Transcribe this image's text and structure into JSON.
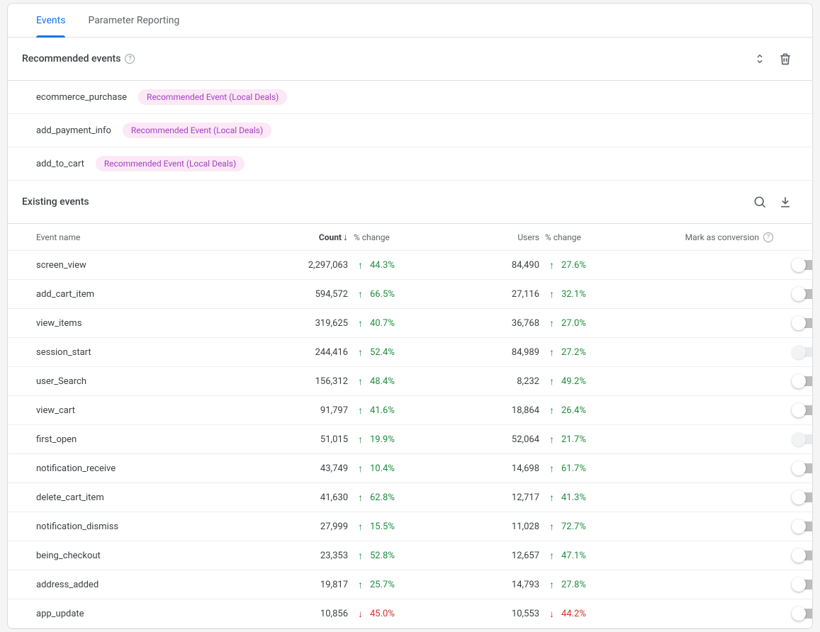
{
  "tabs": {
    "events": "Events",
    "parameter_reporting": "Parameter Reporting"
  },
  "recommended": {
    "header": "Recommended events",
    "items": [
      {
        "name": "ecommerce_purchase",
        "badge": "Recommended Event (Local Deals)"
      },
      {
        "name": "add_payment_info",
        "badge": "Recommended Event (Local Deals)"
      },
      {
        "name": "add_to_cart",
        "badge": "Recommended Event (Local Deals)"
      }
    ]
  },
  "existing": {
    "header": "Existing events",
    "columns": {
      "event_name": "Event name",
      "count": "Count",
      "count_change": "% change",
      "users": "Users",
      "users_change": "% change",
      "mark": "Mark as conversion"
    },
    "rows": [
      {
        "name": "screen_view",
        "count": "2,297,063",
        "count_change": "44.3%",
        "count_dir": "up",
        "users": "84,490",
        "users_change": "27.6%",
        "users_dir": "up",
        "toggle": "off"
      },
      {
        "name": "add_cart_item",
        "count": "594,572",
        "count_change": "66.5%",
        "count_dir": "up",
        "users": "27,116",
        "users_change": "32.1%",
        "users_dir": "up",
        "toggle": "off"
      },
      {
        "name": "view_items",
        "count": "319,625",
        "count_change": "40.7%",
        "count_dir": "up",
        "users": "36,768",
        "users_change": "27.0%",
        "users_dir": "up",
        "toggle": "off"
      },
      {
        "name": "session_start",
        "count": "244,416",
        "count_change": "52.4%",
        "count_dir": "up",
        "users": "84,989",
        "users_change": "27.2%",
        "users_dir": "up",
        "toggle": "disabled"
      },
      {
        "name": "user_Search",
        "count": "156,312",
        "count_change": "48.4%",
        "count_dir": "up",
        "users": "8,232",
        "users_change": "49.2%",
        "users_dir": "up",
        "toggle": "off"
      },
      {
        "name": "view_cart",
        "count": "91,797",
        "count_change": "41.6%",
        "count_dir": "up",
        "users": "18,864",
        "users_change": "26.4%",
        "users_dir": "up",
        "toggle": "off"
      },
      {
        "name": "first_open",
        "count": "51,015",
        "count_change": "19.9%",
        "count_dir": "up",
        "users": "52,064",
        "users_change": "21.7%",
        "users_dir": "up",
        "toggle": "disabled"
      },
      {
        "name": "notification_receive",
        "count": "43,749",
        "count_change": "10.4%",
        "count_dir": "up",
        "users": "14,698",
        "users_change": "61.7%",
        "users_dir": "up",
        "toggle": "off"
      },
      {
        "name": "delete_cart_item",
        "count": "41,630",
        "count_change": "62.8%",
        "count_dir": "up",
        "users": "12,717",
        "users_change": "41.3%",
        "users_dir": "up",
        "toggle": "off"
      },
      {
        "name": "notification_dismiss",
        "count": "27,999",
        "count_change": "15.5%",
        "count_dir": "up",
        "users": "11,028",
        "users_change": "72.7%",
        "users_dir": "up",
        "toggle": "off"
      },
      {
        "name": "being_checkout",
        "count": "23,353",
        "count_change": "52.8%",
        "count_dir": "up",
        "users": "12,657",
        "users_change": "47.1%",
        "users_dir": "up",
        "toggle": "off"
      },
      {
        "name": "address_added",
        "count": "19,817",
        "count_change": "25.7%",
        "count_dir": "up",
        "users": "14,793",
        "users_change": "27.8%",
        "users_dir": "up",
        "toggle": "off"
      },
      {
        "name": "app_update",
        "count": "10,856",
        "count_change": "45.0%",
        "count_dir": "down",
        "users": "10,553",
        "users_change": "44.2%",
        "users_dir": "down",
        "toggle": "off"
      }
    ]
  }
}
